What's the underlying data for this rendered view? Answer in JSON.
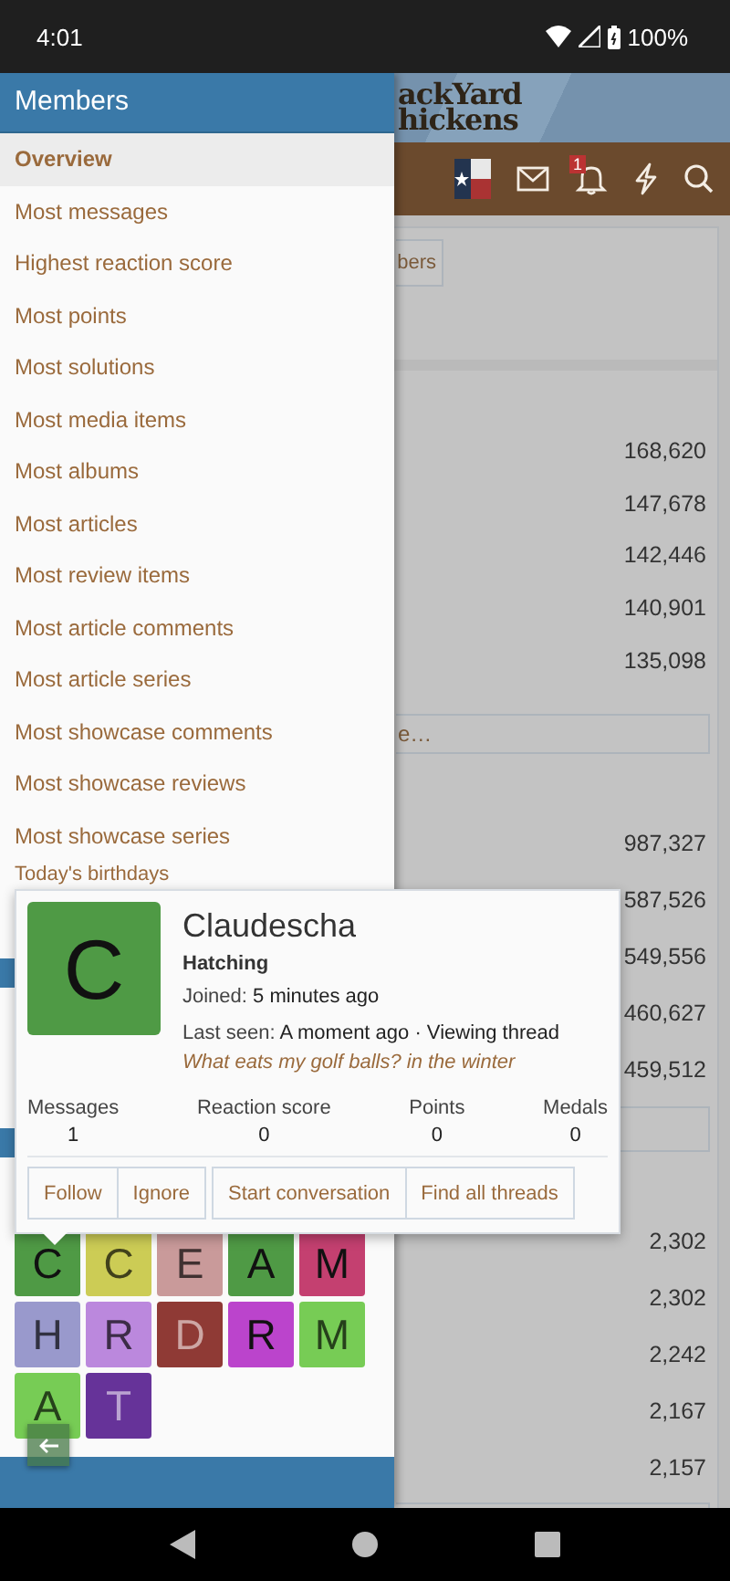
{
  "status_bar": {
    "time": "4:01",
    "battery": "100%"
  },
  "site": {
    "logo_lines": [
      "ackYard",
      "hickens"
    ],
    "notification_count": "1",
    "tab_button": "bers",
    "more_button": "e…",
    "stat_groups": [
      [
        "168,620",
        "147,678",
        "142,446",
        "140,901",
        "135,098"
      ],
      [
        "987,327",
        "587,526",
        "549,556",
        "460,627",
        "459,512"
      ],
      [
        "2,302",
        "2,302",
        "2,242",
        "2,167",
        "2,157"
      ]
    ]
  },
  "drawer": {
    "title": "Members",
    "items": [
      {
        "label": "Overview",
        "selected": true
      },
      {
        "label": "Most messages",
        "selected": false
      },
      {
        "label": "Highest reaction score",
        "selected": false
      },
      {
        "label": "Most points",
        "selected": false
      },
      {
        "label": "Most solutions",
        "selected": false
      },
      {
        "label": "Most media items",
        "selected": false
      },
      {
        "label": "Most albums",
        "selected": false
      },
      {
        "label": "Most articles",
        "selected": false
      },
      {
        "label": "Most review items",
        "selected": false
      },
      {
        "label": "Most article comments",
        "selected": false
      },
      {
        "label": "Most article series",
        "selected": false
      },
      {
        "label": "Most showcase comments",
        "selected": false
      },
      {
        "label": "Most showcase reviews",
        "selected": false
      },
      {
        "label": "Most showcase series",
        "selected": false
      }
    ],
    "section_label": "Today's birthdays",
    "avatars": [
      {
        "letter": "C",
        "color": "#4f9a45"
      },
      {
        "letter": "C",
        "color": "#cccc55"
      },
      {
        "letter": "E",
        "color": "#c99a9a"
      },
      {
        "letter": "A",
        "color": "#4f9a45"
      },
      {
        "letter": "M",
        "color": "#c44070"
      },
      {
        "letter": "H",
        "color": "#9999cc"
      },
      {
        "letter": "R",
        "color": "#bb88dd"
      },
      {
        "letter": "D",
        "color": "#8f3a35"
      },
      {
        "letter": "R",
        "color": "#bb44cc"
      },
      {
        "letter": "M",
        "color": "#77cc55"
      },
      {
        "letter": "A",
        "color": "#77cc55"
      },
      {
        "letter": "T",
        "color": "#663399"
      }
    ]
  },
  "popup": {
    "avatar": {
      "letter": "C",
      "color": "#4f9a45"
    },
    "name": "Claudescha",
    "user_title": "Hatching",
    "joined_label": "Joined:",
    "joined_value": "5 minutes ago",
    "last_seen_label": "Last seen:",
    "last_seen_value": "A moment ago · Viewing thread",
    "thread_link": "What eats my golf balls? in the winter",
    "stats": [
      {
        "label": "Messages",
        "value": "1"
      },
      {
        "label": "Reaction score",
        "value": "0"
      },
      {
        "label": "Points",
        "value": "0"
      },
      {
        "label": "Medals",
        "value": "0"
      }
    ],
    "button_groups": [
      [
        "Follow",
        "Ignore"
      ],
      [
        "Start conversation",
        "Find all threads"
      ]
    ]
  }
}
